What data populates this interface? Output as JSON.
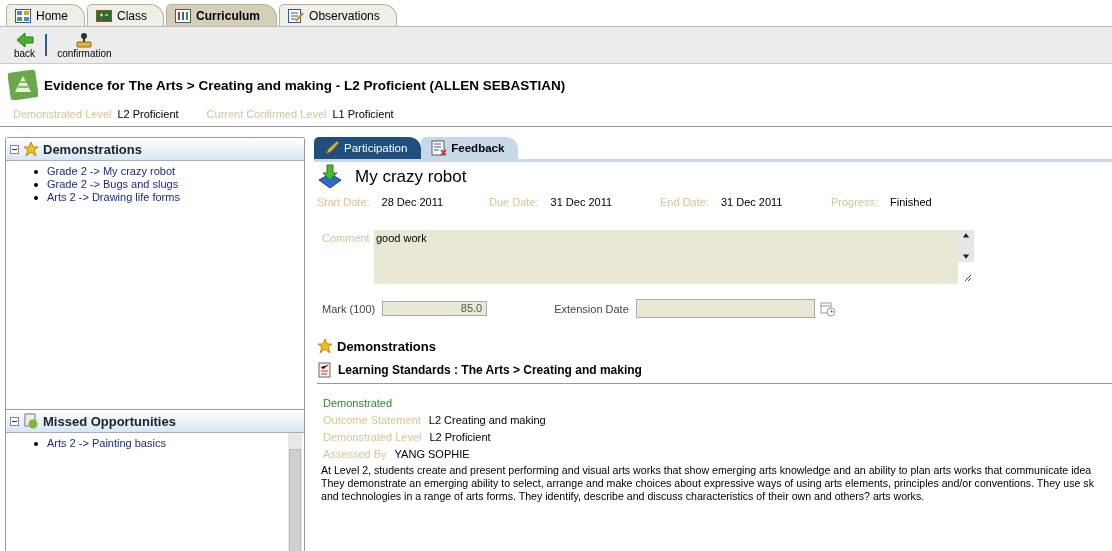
{
  "tabs": [
    {
      "label": "Home",
      "kind": "home",
      "selected": false
    },
    {
      "label": "Class",
      "kind": "class",
      "selected": false
    },
    {
      "label": "Curriculum",
      "kind": "curriculum",
      "selected": true
    },
    {
      "label": "Observations",
      "kind": "observations",
      "selected": false
    }
  ],
  "toolbar": [
    {
      "label": "back",
      "kind": "back"
    },
    {
      "label": "confirmation",
      "kind": "confirm"
    }
  ],
  "header": {
    "title": "Evidence for The Arts > Creating and making - L2 Proficient (ALLEN SEBASTIAN)",
    "levels": [
      {
        "label": "Demonstrated Level",
        "value": "L2 Proficient"
      },
      {
        "label": "Current Confirmed Level",
        "value": "L1 Proficient"
      }
    ]
  },
  "panels": [
    {
      "title": "Demonstrations",
      "kind": "star",
      "expanded": true,
      "items": [
        "Grade 2 -> My crazy robot",
        "Grade 2 -> Bugs and slugs",
        "Arts 2 -> Drawing life forms"
      ]
    },
    {
      "title": "Missed Opportunities",
      "kind": "missed",
      "expanded": true,
      "items": [
        "Arts 2 -> Painting basics"
      ]
    }
  ],
  "subtabs": [
    {
      "label": "Participation",
      "selected": false
    },
    {
      "label": "Feedback",
      "selected": true
    }
  ],
  "task": {
    "title": "My crazy robot",
    "dates": [
      {
        "label": "Start Date:",
        "value": "28 Dec 2011"
      },
      {
        "label": "Due Date:",
        "value": "31 Dec 2011"
      },
      {
        "label": "End Date:",
        "value": "31 Dec 2011"
      },
      {
        "label": "Progress:",
        "value": "Finished"
      }
    ],
    "comment": {
      "label": "Comment",
      "value": "good work"
    },
    "mark": {
      "label": "Mark (100)",
      "value": "85.0"
    },
    "extension": {
      "label": "Extension Date"
    }
  },
  "demonstrations": {
    "title": "Demonstrations",
    "standards": "Learning Standards : The Arts > Creating and making",
    "status": "Demonstrated",
    "details": [
      {
        "label": "Outcome Statement",
        "value": "L2 Creating and making"
      },
      {
        "label": "Demonstrated Level",
        "value": "L2 Proficient"
      },
      {
        "label": "Assessed By",
        "value": "YANG SOPHIE"
      }
    ],
    "description": [
      "At Level 2, students create and present performing and visual arts works that show emerging arts knowledge and an ability to plan arts works that communicate idea",
      "They demonstrate an emerging ability to select, arrange and make choices about expressive ways of using arts elements, principles and/or conventions. They use sk",
      "and technologies in a range of arts forms. They identify, describe and discuss characteristics of their own and others? arts works."
    ]
  }
}
